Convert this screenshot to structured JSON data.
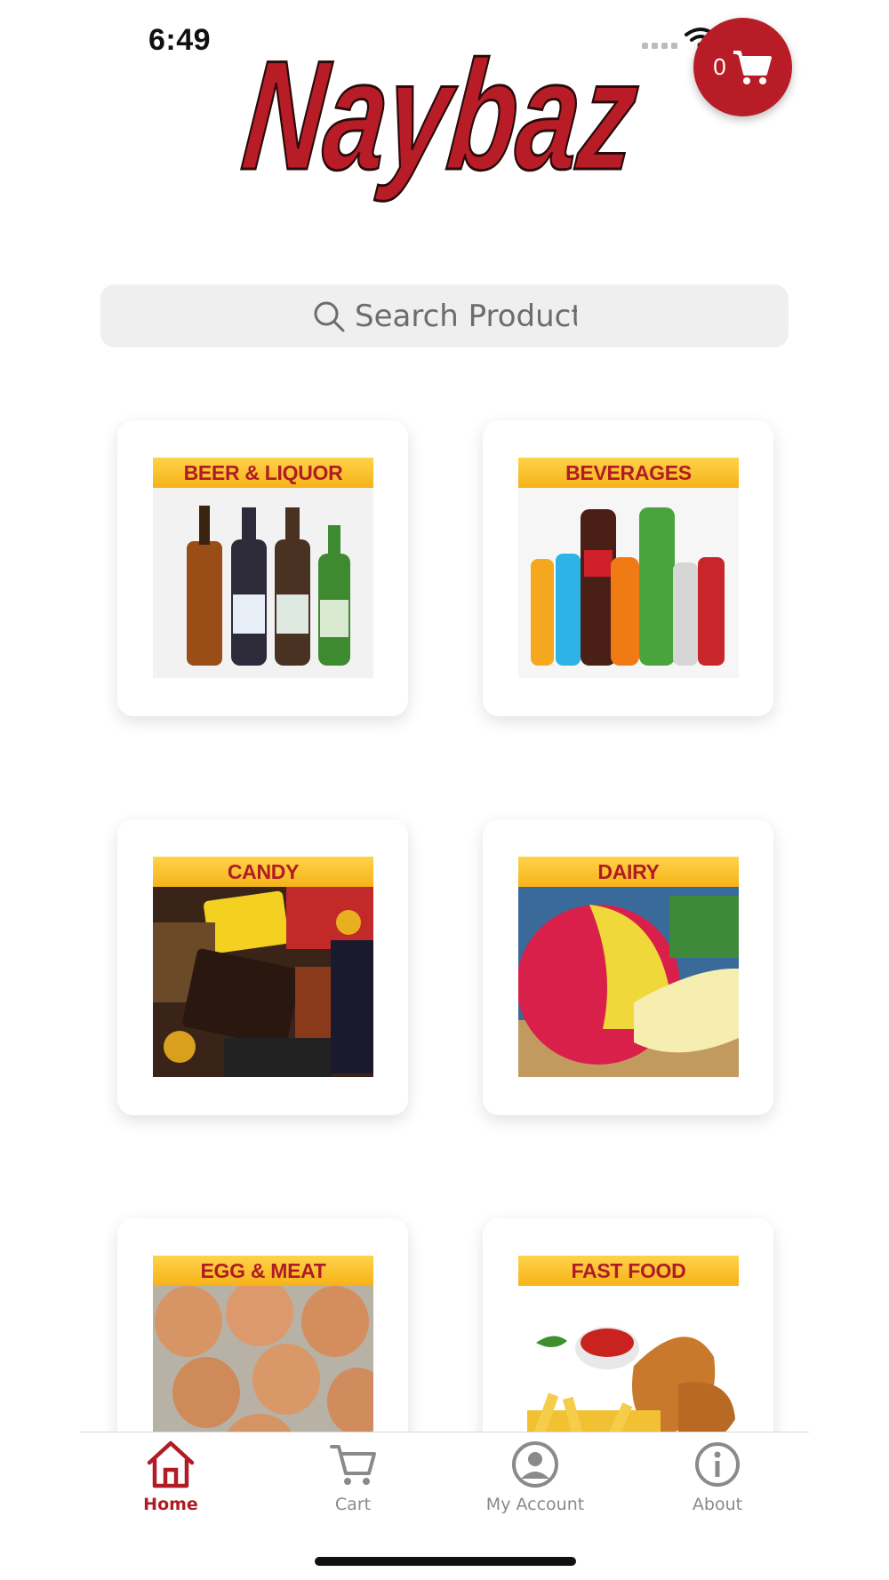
{
  "status_bar": {
    "time": "6:49"
  },
  "brand": {
    "logo_text": "Naybaz",
    "primary_color": "#b81d27",
    "label_gradient": [
      "#ffd24a",
      "#f6b318"
    ]
  },
  "cart": {
    "count": "0"
  },
  "search": {
    "placeholder": "Search Products"
  },
  "categories": [
    {
      "label": "BEER & LIQUOR"
    },
    {
      "label": "BEVERAGES"
    },
    {
      "label": "CANDY"
    },
    {
      "label": "DAIRY"
    },
    {
      "label": "EGG & MEAT"
    },
    {
      "label": "FAST FOOD"
    }
  ],
  "tabs": [
    {
      "label": "Home",
      "icon": "home-icon",
      "active": true
    },
    {
      "label": "Cart",
      "icon": "cart-icon",
      "active": false
    },
    {
      "label": "My Account",
      "icon": "account-icon",
      "active": false
    },
    {
      "label": "About",
      "icon": "info-icon",
      "active": false
    }
  ]
}
